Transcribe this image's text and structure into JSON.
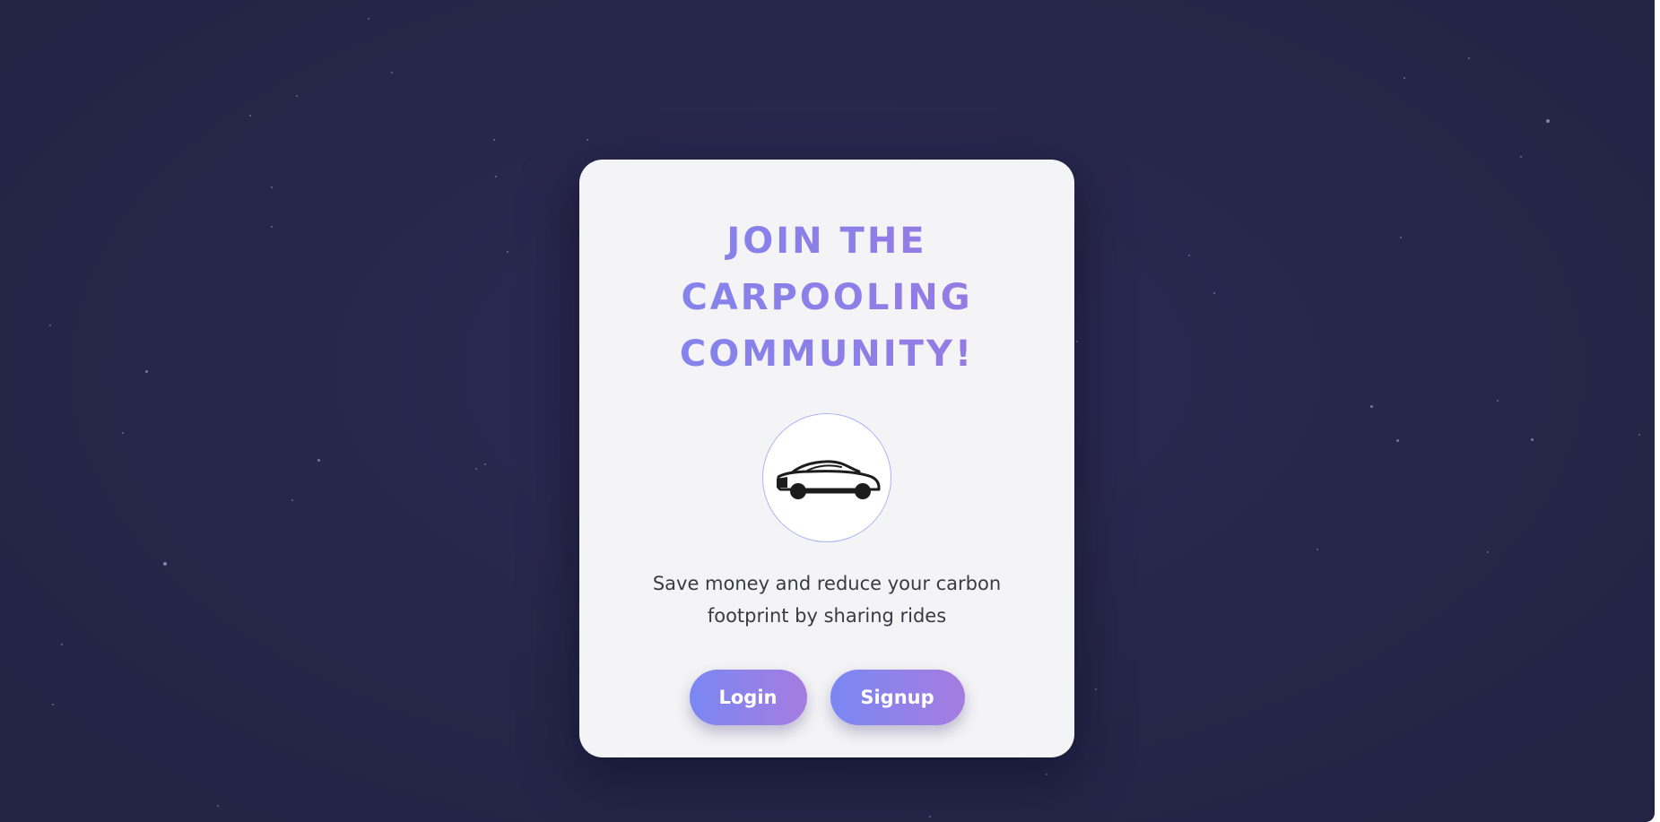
{
  "page": {
    "title_lines": [
      "JOIN THE",
      "CARPOOLING",
      "COMMUNITY!"
    ],
    "logo_icon": "car-icon",
    "tagline_lines": [
      "Save money and reduce your carbon",
      "footprint by sharing rides"
    ],
    "buttons": {
      "login_label": "Login",
      "signup_label": "Signup"
    }
  },
  "colors": {
    "background": "#26264a",
    "card": "#f4f4f6",
    "accent_start": "#7a87f3",
    "accent_end": "#a67ce0",
    "text": "#3a3a44"
  }
}
